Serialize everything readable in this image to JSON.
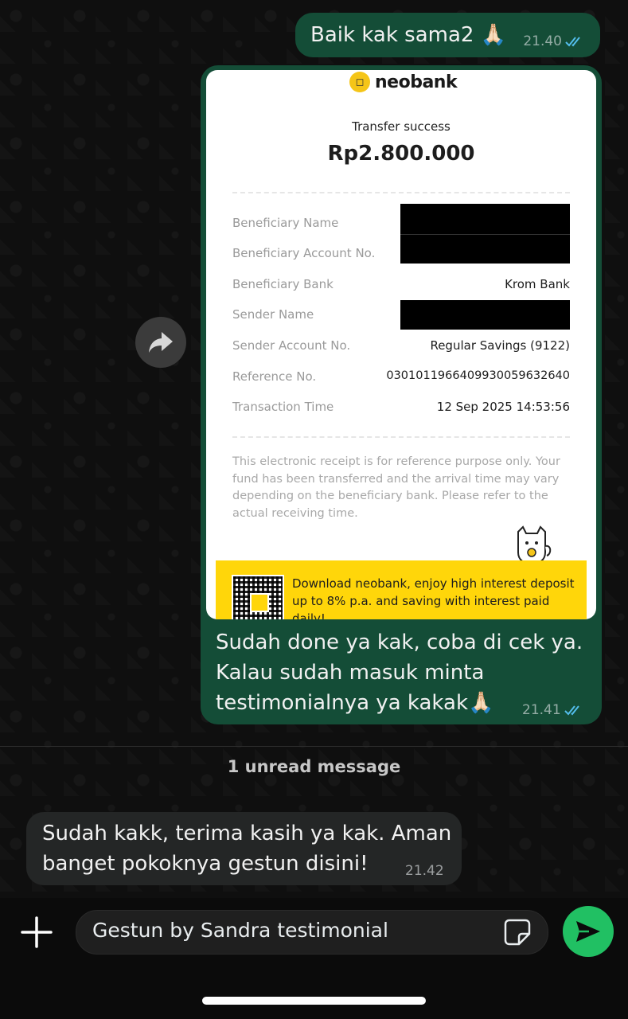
{
  "messages": {
    "out1": {
      "text": "Baik kak sama2 🙏🏻",
      "time": "21.40"
    },
    "out2": {
      "lines": [
        "Sudah done ya kak, coba di cek ya.",
        "Kalau sudah masuk minta",
        "testimonialnya ya kakak🙏🏻"
      ],
      "time": "21.41"
    },
    "in1": {
      "lines": [
        "Sudah kakk, terima kasih ya kak. Aman",
        "banget pokoknya gestun disini!"
      ],
      "time": "21.42"
    }
  },
  "receipt": {
    "logo": "neobank",
    "status": "Transfer success",
    "amount": "Rp2.800.000",
    "rows": [
      {
        "label": "Beneficiary Name",
        "value": ""
      },
      {
        "label": "Beneficiary Account No.",
        "value": ""
      },
      {
        "label": "Beneficiary Bank",
        "value": "Krom Bank"
      },
      {
        "label": "Sender Name",
        "value": ""
      },
      {
        "label": "Sender Account No.",
        "value": "Regular Savings (9122)"
      },
      {
        "label": "Reference No.",
        "value": "03010119664099300596326​40"
      },
      {
        "label": "Transaction Time",
        "value": "12 Sep 2025 14:53:56"
      }
    ],
    "note": "This electronic receipt is for reference purpose only. Your fund has been transferred and the arrival time may vary depending on the beneficiary bank. Please refer to the actual receiving time.",
    "banner": "Download neobank, enjoy high interest deposit up to 8% p.a. and saving with interest paid daily!"
  },
  "divider": {
    "unread": "1 unread message"
  },
  "composer": {
    "input_value": "Gestun by Sandra testimonial"
  },
  "colors": {
    "outgoing": "#144d37",
    "incoming": "#242626",
    "send": "#21c063",
    "ticks": "#53bdeb",
    "banner": "#ffd60a"
  },
  "icons": [
    "forward-icon",
    "plus-icon",
    "sticker-icon",
    "send-icon",
    "double-check-icon"
  ]
}
